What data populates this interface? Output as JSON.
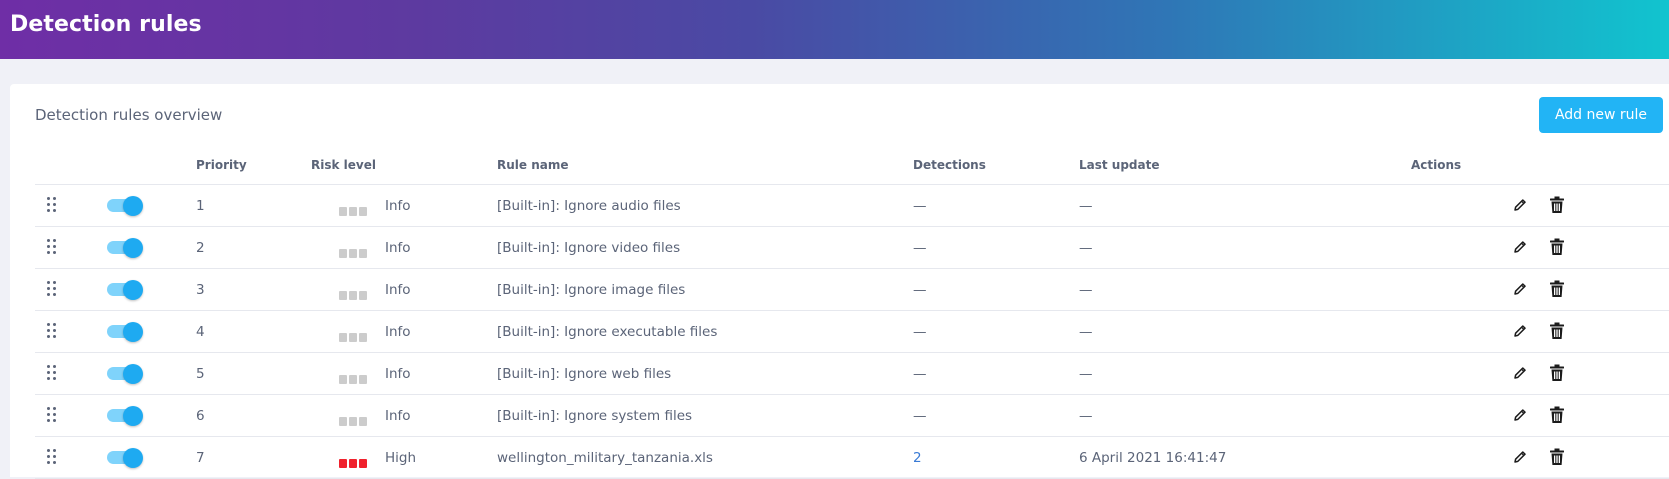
{
  "header": {
    "title": "Detection rules"
  },
  "card": {
    "title": "Detection rules overview",
    "add_button": "Add new rule"
  },
  "table": {
    "columns": {
      "priority": "Priority",
      "risk_level": "Risk level",
      "rule_name": "Rule name",
      "detections": "Detections",
      "last_update": "Last update",
      "actions": "Actions"
    },
    "rows": [
      {
        "enabled": true,
        "priority": "1",
        "risk_level": "Info",
        "risk_color": "#cccccc",
        "rule_name": "[Built-in]: Ignore audio files",
        "detections": "—",
        "last_update": "—"
      },
      {
        "enabled": true,
        "priority": "2",
        "risk_level": "Info",
        "risk_color": "#cccccc",
        "rule_name": "[Built-in]: Ignore video files",
        "detections": "—",
        "last_update": "—"
      },
      {
        "enabled": true,
        "priority": "3",
        "risk_level": "Info",
        "risk_color": "#cccccc",
        "rule_name": "[Built-in]: Ignore image files",
        "detections": "—",
        "last_update": "—"
      },
      {
        "enabled": true,
        "priority": "4",
        "risk_level": "Info",
        "risk_color": "#cccccc",
        "rule_name": "[Built-in]: Ignore executable files",
        "detections": "—",
        "last_update": "—"
      },
      {
        "enabled": true,
        "priority": "5",
        "risk_level": "Info",
        "risk_color": "#cccccc",
        "rule_name": "[Built-in]: Ignore web files",
        "detections": "—",
        "last_update": "—"
      },
      {
        "enabled": true,
        "priority": "6",
        "risk_level": "Info",
        "risk_color": "#cccccc",
        "rule_name": "[Built-in]: Ignore system files",
        "detections": "—",
        "last_update": "—"
      },
      {
        "enabled": true,
        "priority": "7",
        "risk_level": "High",
        "risk_color": "#f0212c",
        "rule_name": "wellington_military_tanzania.xls",
        "detections": "2",
        "last_update": "6 April 2021 16:41:47"
      }
    ]
  },
  "icons": {
    "drag_handle": "drag-handle-icon",
    "edit": "pencil-icon",
    "delete": "trash-icon"
  },
  "colors": {
    "accent": "#1eaaf1",
    "button": "#22b4f5",
    "risk_info": "#cccccc",
    "risk_high": "#f0212c",
    "link": "#3a7bd5"
  }
}
